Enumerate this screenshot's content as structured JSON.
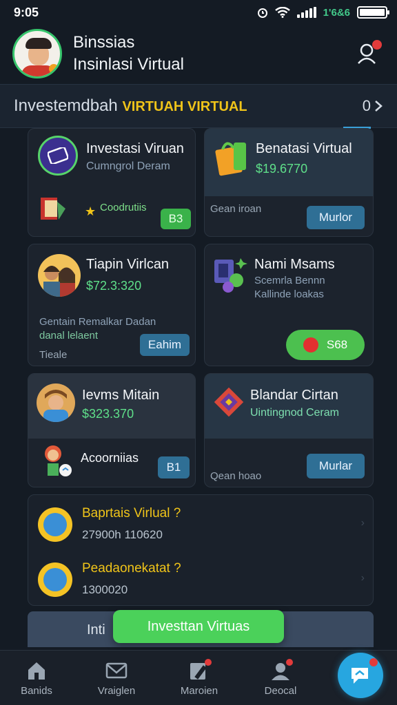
{
  "status_bar": {
    "time": "9:05",
    "network": "1'6&6"
  },
  "header": {
    "title_line1": "Binssias",
    "title_line2": "Insinlasi Virtual"
  },
  "section": {
    "title_prefix": "Investemdbah",
    "title_highlight": "VIRTUAH VIRTUAL",
    "more_label": "0"
  },
  "cards": [
    {
      "title": "Investasi Viruan",
      "subtitle": "Cumngrol Deram",
      "tag": "Coodrutiis",
      "button": "B3"
    },
    {
      "title": "Benatasi Virtual",
      "amount": "$19.6770",
      "note": "Gean iroan",
      "button": "Murlor"
    },
    {
      "title": "Tiapin Virlcan",
      "amount": "$72.3:320",
      "desc_line1": "Gentain Remalkar Dadan",
      "desc_line2": "danal lelaent",
      "note": "Tieale",
      "button": "Eahim"
    },
    {
      "title": "Nami Msams",
      "subtitle_line1": "Scemrla Bennn",
      "subtitle_line2": "Kallinde loakas",
      "button": "S68"
    },
    {
      "title": "Ievms Mitain",
      "amount": "$323.370",
      "tag": "Acoorniias",
      "button": "B1"
    },
    {
      "title": "Blandar Cirtan",
      "subtitle": "Uintingnod Ceram",
      "note": "Qean hoao",
      "button": "Murlar"
    }
  ],
  "info_rows": [
    {
      "title": "Baprtais Virlual ?",
      "value": "27900h 110620"
    },
    {
      "title": "Peadaonekatat ?",
      "value": "1300020"
    }
  ],
  "bottom_strip_text": "Inti",
  "cta_label": "Investtan Virtuas",
  "nav": [
    {
      "label": "Banids",
      "icon": "home-icon"
    },
    {
      "label": "Vraiglen",
      "icon": "mail-icon"
    },
    {
      "label": "Maroien",
      "icon": "edit-icon"
    },
    {
      "label": "Deocal",
      "icon": "user-icon"
    }
  ],
  "colors": {
    "background": "#141b24",
    "accent_green": "#4bd15a",
    "accent_gold": "#f0c419",
    "accent_blue": "#27a6e0"
  }
}
